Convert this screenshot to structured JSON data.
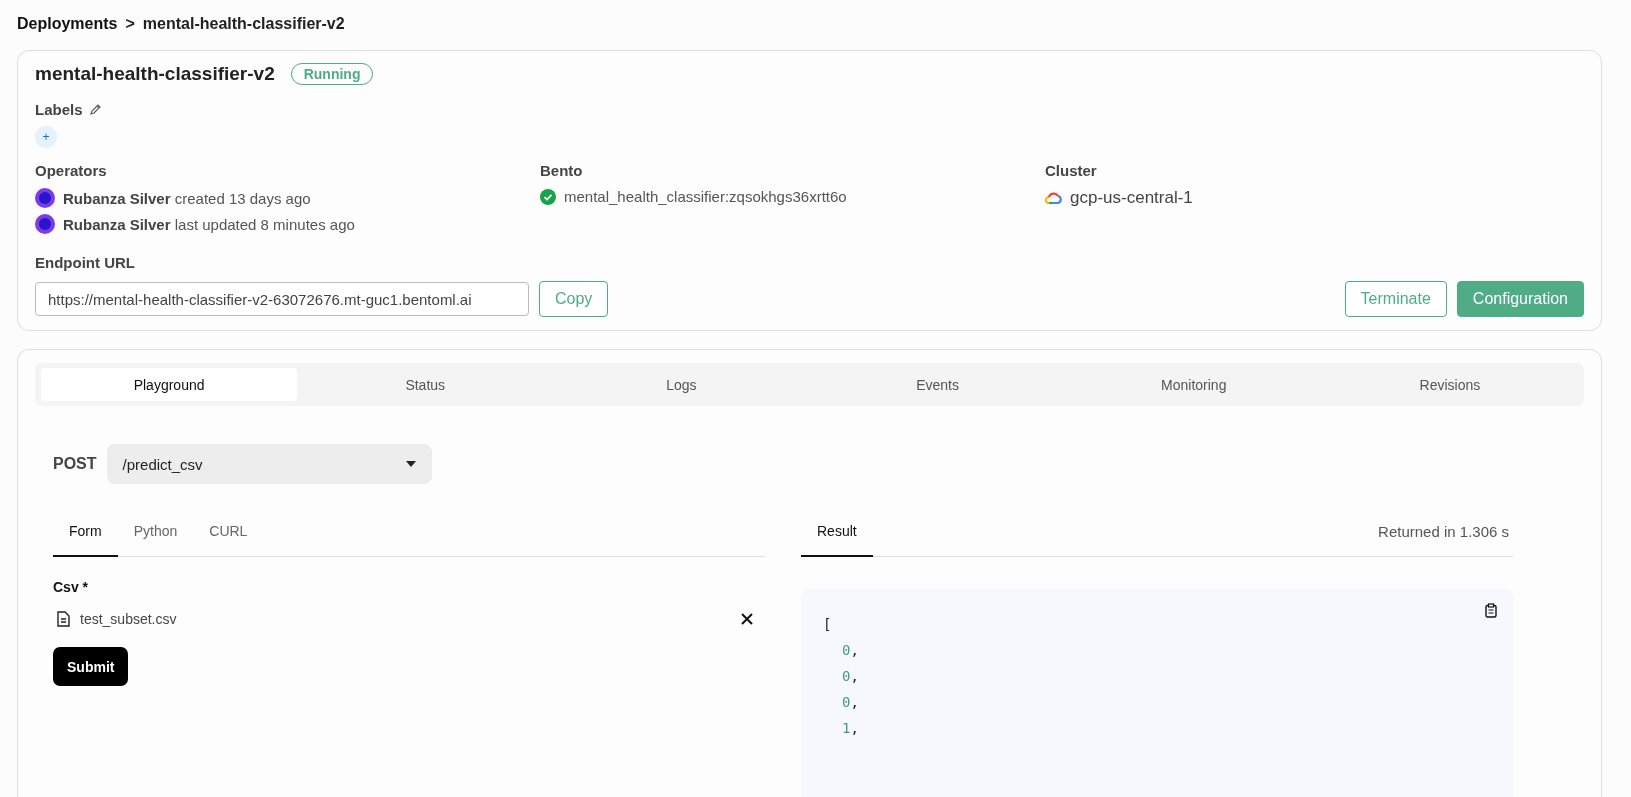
{
  "breadcrumb": {
    "parent": "Deployments",
    "separator": ">",
    "current": "mental-health-classifier-v2"
  },
  "deployment": {
    "title": "mental-health-classifier-v2",
    "status": "Running",
    "labels": {
      "heading": "Labels",
      "add": "+"
    },
    "operators": {
      "heading": "Operators",
      "items": [
        {
          "text": "**Rubanza Silver** created 13 days ago"
        },
        {
          "text": "**Rubanza Silver** last updated 8 minutes ago"
        }
      ]
    },
    "bento": {
      "heading": "Bento",
      "value": "mental_health_classifier:zqsokhgs36xrtt6o"
    },
    "cluster": {
      "heading": "Cluster",
      "value": "gcp-us-central-1"
    },
    "endpoint": {
      "heading": "Endpoint URL",
      "value": "https://mental-health-classifier-v2-63072676.mt-guc1.bentoml.ai",
      "copy": "Copy"
    },
    "buttons": [
      {
        "label": "Terminate",
        "kind": "outline"
      },
      {
        "label": "Configuration",
        "kind": "primary"
      }
    ]
  },
  "tabs": [
    {
      "label": "Playground",
      "selected": true
    },
    {
      "label": "Status",
      "selected": false
    },
    {
      "label": "Logs",
      "selected": false
    },
    {
      "label": "Events",
      "selected": false
    },
    {
      "label": "Monitoring",
      "selected": false
    },
    {
      "label": "Revisions",
      "selected": false
    }
  ],
  "playground": {
    "method": "POST",
    "endpoint": "/predict_csv",
    "input_tabs": [
      {
        "label": "Form",
        "selected": true
      },
      {
        "label": "Python",
        "selected": false
      },
      {
        "label": "CURL",
        "selected": false
      }
    ],
    "field": {
      "label": "Csv *",
      "file": "test_subset.csv"
    },
    "submit": "Submit",
    "result_tabs": [
      {
        "label": "Result",
        "selected": true
      }
    ],
    "returned": "Returned in 1.306 s",
    "result": {
      "open": "[",
      "lines": [
        {
          "value": "0",
          "suffix": ","
        },
        {
          "value": "0",
          "suffix": ","
        },
        {
          "value": "0",
          "suffix": ","
        },
        {
          "value": "1",
          "suffix": ","
        }
      ]
    }
  }
}
